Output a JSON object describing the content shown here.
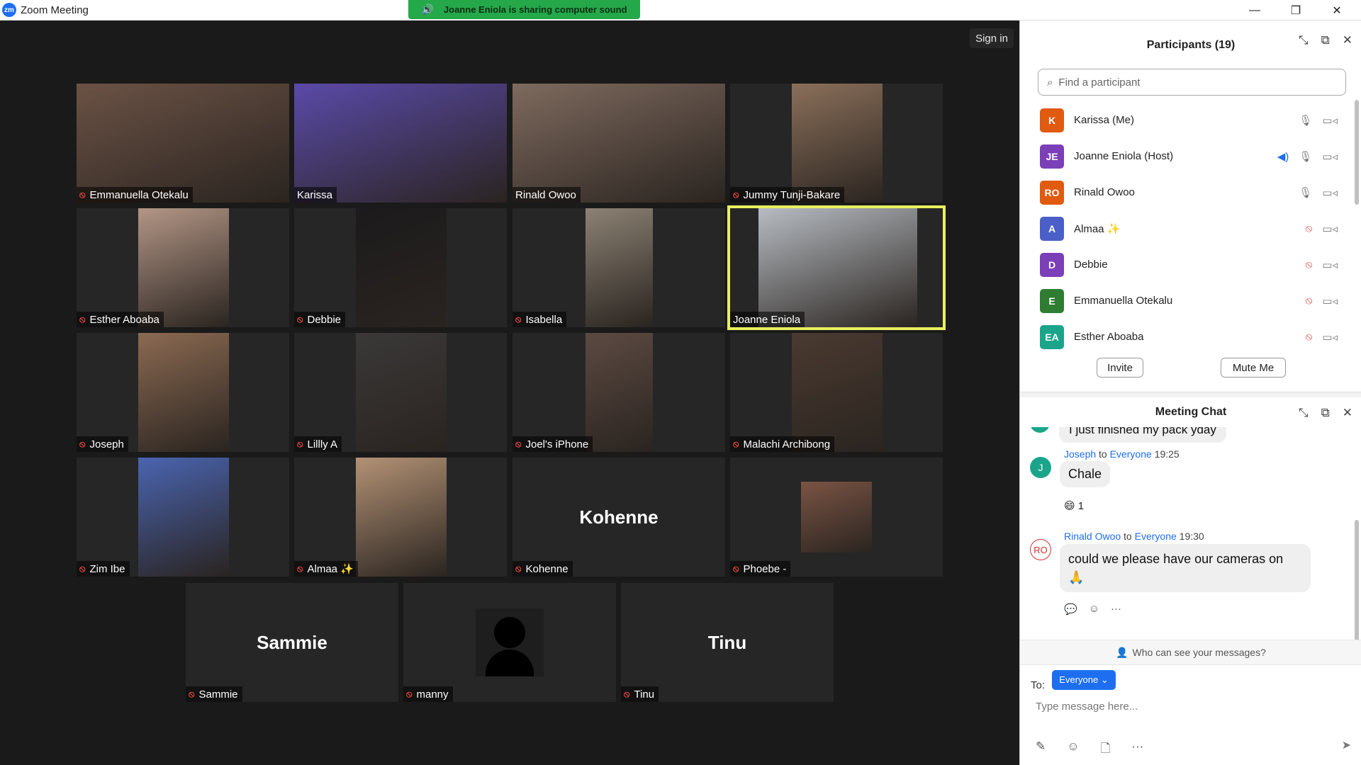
{
  "window": {
    "title": "Zoom Meeting",
    "logo_text": "zm",
    "minimize": "—",
    "restore": "❐",
    "close": "✕"
  },
  "share_banner": {
    "text": "Joanne Eniola is sharing computer sound"
  },
  "signin_label": "Sign in",
  "tiles": [
    {
      "name": "Emmanuella Otekalu",
      "muted": true,
      "video_color": "#6b5245"
    },
    {
      "name": "Karissa",
      "muted": false,
      "video_color": "#5a4aa8"
    },
    {
      "name": "Rinald Owoo",
      "muted": false,
      "video_color": "#7e6a5e"
    },
    {
      "name": "Jummy Tunji-Bakare",
      "muted": true,
      "video_color": "#8a6f5a"
    },
    {
      "name": "Esther Aboaba",
      "muted": true,
      "video_color": "#b39686"
    },
    {
      "name": "Debbie",
      "muted": true,
      "video_color": "#1c1a1c"
    },
    {
      "name": "Isabella",
      "muted": true,
      "video_color": "#8c8274"
    },
    {
      "name": "Joanne Eniola",
      "muted": false,
      "video_color": "#b7bcc2",
      "active_speaker": true
    },
    {
      "name": "Joseph",
      "muted": true,
      "video_color": "#8b6a52"
    },
    {
      "name": "Lillly A",
      "muted": true,
      "video_color": "#3a3838"
    },
    {
      "name": "Joel's iPhone",
      "muted": true,
      "video_color": "#5c4a42"
    },
    {
      "name": "Malachi Archibong",
      "muted": true,
      "video_color": "#4a3a30"
    },
    {
      "name": "Zim Ibe",
      "muted": true,
      "video_color": "#4a64b0"
    },
    {
      "name": "Almaa ✨",
      "muted": true,
      "video_color": "#b39275"
    },
    {
      "name": "Kohenne",
      "muted": true,
      "big_label": "Kohenne"
    },
    {
      "name": "Phoebe -",
      "muted": true,
      "video_color": "#7a5444"
    },
    {
      "name": "Sammie",
      "muted": true,
      "big_label": "Sammie"
    },
    {
      "name": "manny",
      "muted": true,
      "avatar": true
    },
    {
      "name": "Tinu",
      "muted": true,
      "big_label": "Tinu"
    }
  ],
  "participants_panel": {
    "title": "Participants (19)",
    "search_placeholder": "Find a participant",
    "participants": [
      {
        "initials": "K",
        "name": "Karissa (Me)",
        "color": "#e05a10",
        "mic": "on",
        "speaking": false
      },
      {
        "initials": "JE",
        "name": "Joanne Eniola (Host)",
        "color": "#7b3fb8",
        "mic": "on",
        "speaking": true
      },
      {
        "initials": "RO",
        "name": "Rinald Owoo",
        "color": "#e05a10",
        "mic": "on",
        "speaking": false
      },
      {
        "initials": "A",
        "name": "Almaa ✨",
        "color": "#4a5fc8",
        "mic": "muted",
        "speaking": false
      },
      {
        "initials": "D",
        "name": "Debbie",
        "color": "#7b3fb8",
        "mic": "muted",
        "speaking": false
      },
      {
        "initials": "E",
        "name": "Emmanuella Otekalu",
        "color": "#2e7d32",
        "mic": "muted",
        "speaking": false
      },
      {
        "initials": "EA",
        "name": "Esther Aboaba",
        "color": "#1aa58a",
        "mic": "muted",
        "speaking": false
      }
    ],
    "invite_label": "Invite",
    "mute_me_label": "Mute Me"
  },
  "chat_panel": {
    "title": "Meeting Chat",
    "partial_message": "I just finished my pack yday",
    "messages": [
      {
        "sender": "Joseph",
        "to_word": "to",
        "recipient": "Everyone",
        "time": "19:25",
        "avatar": "J",
        "avatar_color": "#1aa58a",
        "text": "Chale",
        "reaction": "😄 1"
      },
      {
        "sender": "Rinald Owoo",
        "to_word": "to",
        "recipient": "Everyone",
        "time": "19:30",
        "avatar": "RO",
        "avatar_color": "#d32f2f",
        "text": "could we please have our cameras on 🙏"
      }
    ],
    "who_can_see": "Who can see your messages?",
    "to_label": "To:",
    "recipient_button": "Everyone ⌄",
    "input_placeholder": "Type message here..."
  }
}
